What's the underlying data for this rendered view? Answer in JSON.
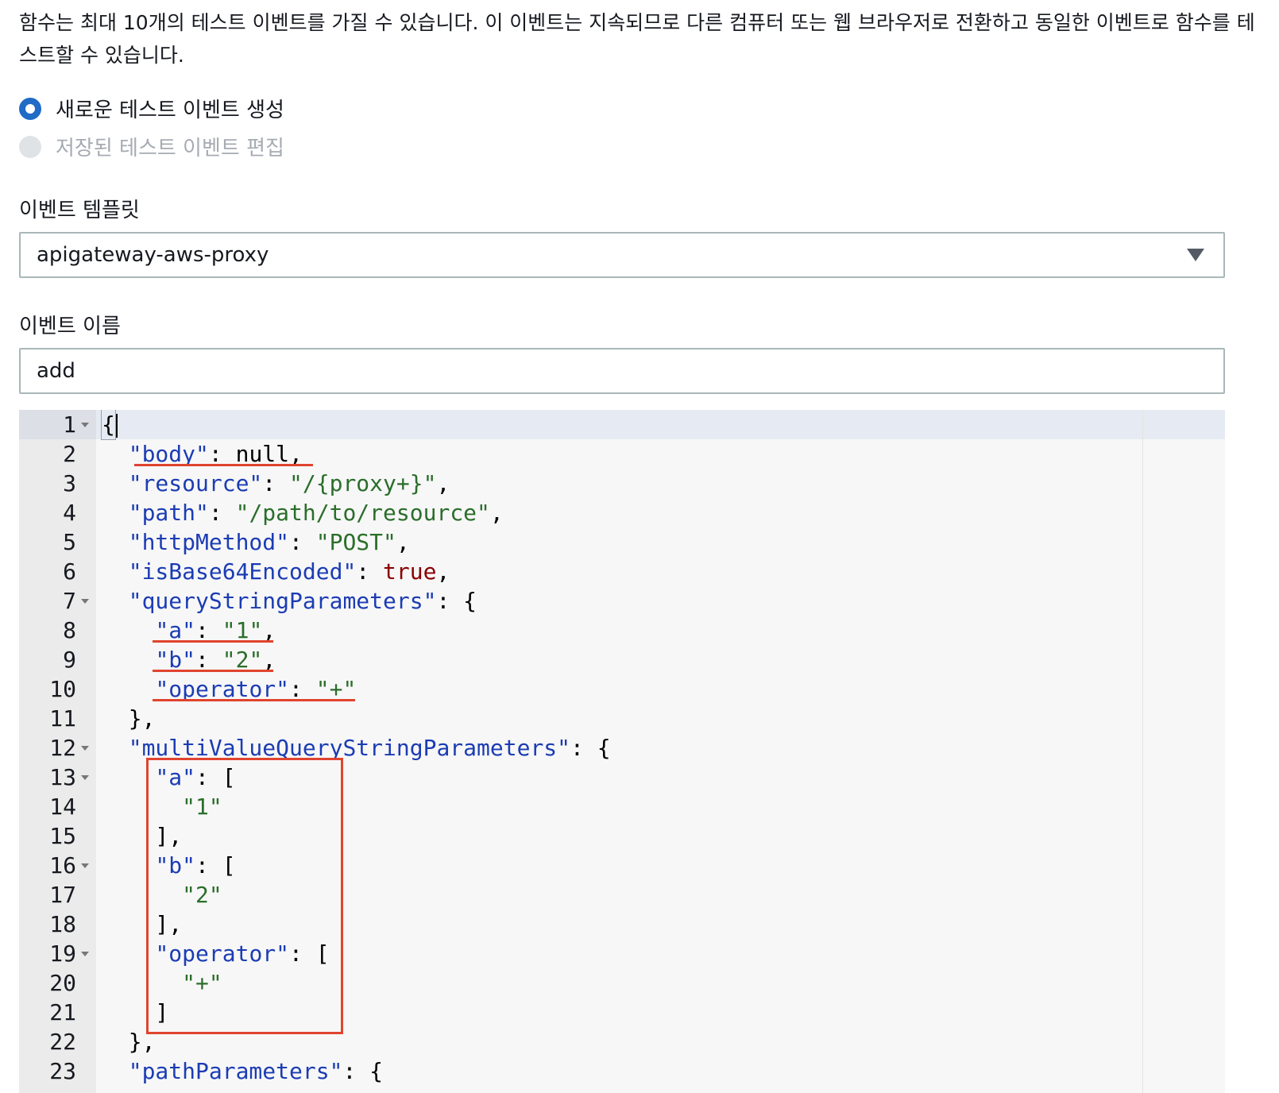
{
  "description": "함수는 최대 10개의 테스트 이벤트를 가질 수 있습니다. 이 이벤트는 지속되므로 다른 컴퓨터 또는 웹 브라우저로 전환하고 동일한 이벤트로 함수를 테스트할 수 있습니다.",
  "options": {
    "create_new": "새로운 테스트 이벤트 생성",
    "edit_saved": "저장된 테스트 이벤트 편집"
  },
  "template": {
    "label": "이벤트 템플릿",
    "selected": "apigateway-aws-proxy"
  },
  "event_name": {
    "label": "이벤트 이름",
    "value": "add"
  },
  "editor": {
    "lines": [
      {
        "n": "1",
        "text": "{"
      },
      {
        "n": "2",
        "text": "  \"body\": null,"
      },
      {
        "n": "3",
        "text": "  \"resource\": \"/{proxy+}\","
      },
      {
        "n": "4",
        "text": "  \"path\": \"/path/to/resource\","
      },
      {
        "n": "5",
        "text": "  \"httpMethod\": \"POST\","
      },
      {
        "n": "6",
        "text": "  \"isBase64Encoded\": true,"
      },
      {
        "n": "7",
        "text": "  \"queryStringParameters\": {"
      },
      {
        "n": "8",
        "text": "    \"a\": \"1\","
      },
      {
        "n": "9",
        "text": "    \"b\": \"2\","
      },
      {
        "n": "10",
        "text": "    \"operator\": \"+\""
      },
      {
        "n": "11",
        "text": "  },"
      },
      {
        "n": "12",
        "text": "  \"multiValueQueryStringParameters\": {"
      },
      {
        "n": "13",
        "text": "    \"a\": ["
      },
      {
        "n": "14",
        "text": "      \"1\""
      },
      {
        "n": "15",
        "text": "    ],"
      },
      {
        "n": "16",
        "text": "    \"b\": ["
      },
      {
        "n": "17",
        "text": "      \"2\""
      },
      {
        "n": "18",
        "text": "    ],"
      },
      {
        "n": "19",
        "text": "    \"operator\": ["
      },
      {
        "n": "20",
        "text": "      \"+\""
      },
      {
        "n": "21",
        "text": "    ]"
      },
      {
        "n": "22",
        "text": "  },"
      },
      {
        "n": "23",
        "text": "  \"pathParameters\": {"
      }
    ],
    "fold_lines": [
      "1",
      "7",
      "12",
      "13",
      "16",
      "19"
    ],
    "colors": {
      "key": "#1b3cb4",
      "string": "#2a6e2a",
      "boolean": "#8b0000",
      "highlight": "#e0442e"
    }
  }
}
